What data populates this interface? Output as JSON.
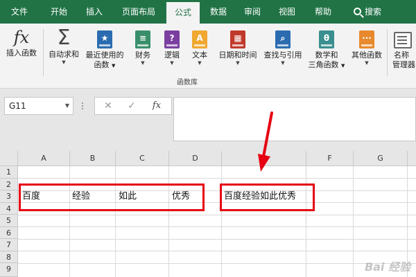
{
  "tabs": [
    {
      "label": "文件"
    },
    {
      "label": "开始"
    },
    {
      "label": "插入"
    },
    {
      "label": "页面布局"
    },
    {
      "label": "公式"
    },
    {
      "label": "数据"
    },
    {
      "label": "审阅"
    },
    {
      "label": "视图"
    },
    {
      "label": "帮助"
    },
    {
      "label": "搜索"
    }
  ],
  "ribbon": {
    "insert_function": {
      "label": "插入函数",
      "icon": "fx"
    },
    "autosum": {
      "label": "自动求和",
      "icon": "Σ"
    },
    "recent": {
      "line1": "最近使用的",
      "line2": "函数"
    },
    "financial": {
      "label": "财务"
    },
    "logical": {
      "label": "逻辑",
      "icon": "?"
    },
    "text": {
      "label": "文本",
      "icon": "A"
    },
    "datetime": {
      "label": "日期和时间"
    },
    "lookup": {
      "label": "查找与引用"
    },
    "math": {
      "line1": "数学和",
      "line2": "三角函数",
      "icon": "θ"
    },
    "more": {
      "label": "其他函数",
      "icon": "···"
    },
    "name_manager": {
      "line1": "名称",
      "line2": "管理器"
    },
    "group_label": "函数库"
  },
  "formula_bar": {
    "name_box": "G11",
    "cancel": "✕",
    "enter": "✓",
    "fx": "fx",
    "content": ""
  },
  "sheet": {
    "columns": [
      "A",
      "B",
      "C",
      "D",
      "E",
      "F",
      "G"
    ],
    "rows": [
      "1",
      "2",
      "3",
      "4",
      "5",
      "6",
      "7",
      "8",
      "9"
    ],
    "cells": {
      "A3": "百度",
      "B3": "经验",
      "C3": "如此",
      "D3": "优秀",
      "E3": "百度经验如此优秀"
    }
  },
  "watermark": "Bai 经验",
  "colors": {
    "accent": "#217346",
    "highlight": "#e60012"
  }
}
